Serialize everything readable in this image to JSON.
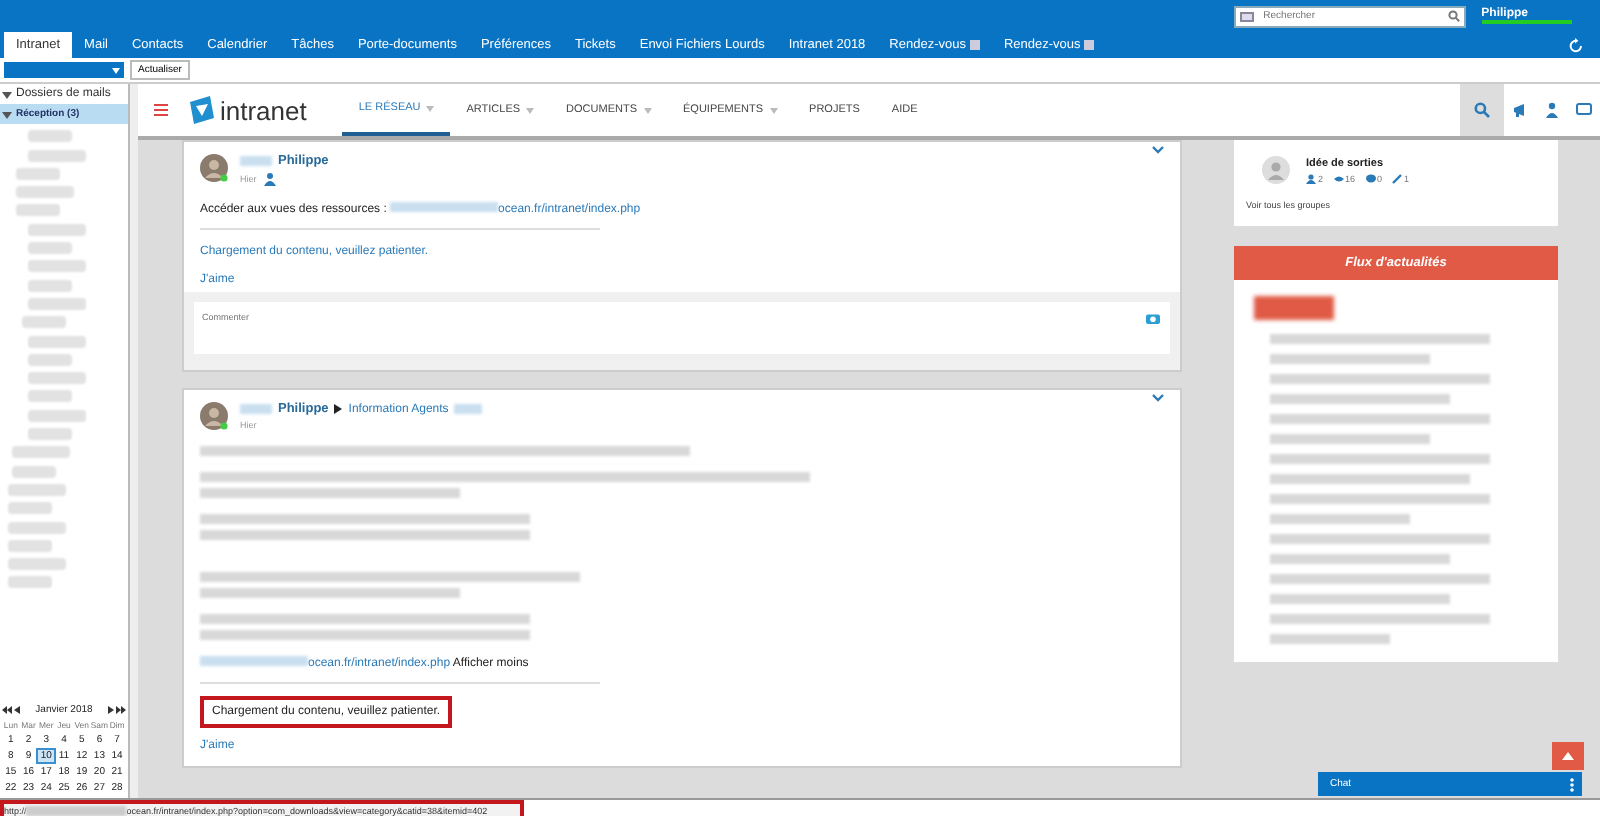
{
  "top_bar": {
    "search": {
      "placeholder": "Rechercher"
    },
    "user": "Philippe"
  },
  "tabs": [
    {
      "label": "Intranet",
      "selected": true,
      "closable": false
    },
    {
      "label": "Mail",
      "selected": false,
      "closable": false
    },
    {
      "label": "Contacts",
      "selected": false,
      "closable": false
    },
    {
      "label": "Calendrier",
      "selected": false,
      "closable": false
    },
    {
      "label": "Tâches",
      "selected": false,
      "closable": false
    },
    {
      "label": "Porte-documents",
      "selected": false,
      "closable": false
    },
    {
      "label": "Préférences",
      "selected": false,
      "closable": false
    },
    {
      "label": "Tickets",
      "selected": false,
      "closable": false
    },
    {
      "label": "Envoi Fichiers Lourds",
      "selected": false,
      "closable": false
    },
    {
      "label": "Intranet 2018",
      "selected": false,
      "closable": false
    },
    {
      "label": "Rendez-vous",
      "selected": false,
      "closable": true
    },
    {
      "label": "Rendez-vous",
      "selected": false,
      "closable": true
    }
  ],
  "toolbar": {
    "button": "Actualiser"
  },
  "mail_folders": {
    "title": "Dossiers de mails",
    "expanded": true,
    "items": [
      {
        "label": "Réception (3)",
        "selected": true
      }
    ]
  },
  "calendar": {
    "month": "Janvier 2018",
    "weekdays": [
      "Lun",
      "Mar",
      "Mer",
      "Jeu",
      "Ven",
      "Sam",
      "Dim"
    ],
    "weeks": [
      [
        {
          "d": "1",
          "selected": false,
          "other": false
        },
        {
          "d": "2",
          "selected": false,
          "other": false
        },
        {
          "d": "3",
          "selected": false,
          "other": false
        },
        {
          "d": "4",
          "selected": false,
          "other": false
        },
        {
          "d": "5",
          "selected": false,
          "other": false
        },
        {
          "d": "6",
          "selected": false,
          "other": false
        },
        {
          "d": "7",
          "selected": false,
          "other": false
        }
      ],
      [
        {
          "d": "8",
          "selected": false,
          "other": false
        },
        {
          "d": "9",
          "selected": false,
          "other": false
        },
        {
          "d": "10",
          "selected": true,
          "other": false
        },
        {
          "d": "11",
          "selected": false,
          "other": false
        },
        {
          "d": "12",
          "selected": false,
          "other": false
        },
        {
          "d": "13",
          "selected": false,
          "other": false
        },
        {
          "d": "14",
          "selected": false,
          "other": false
        }
      ],
      [
        {
          "d": "15",
          "selected": false,
          "other": false
        },
        {
          "d": "16",
          "selected": false,
          "other": false
        },
        {
          "d": "17",
          "selected": false,
          "other": false
        },
        {
          "d": "18",
          "selected": false,
          "other": false
        },
        {
          "d": "19",
          "selected": false,
          "other": false
        },
        {
          "d": "20",
          "selected": false,
          "other": false
        },
        {
          "d": "21",
          "selected": false,
          "other": false
        }
      ],
      [
        {
          "d": "22",
          "selected": false,
          "other": false
        },
        {
          "d": "23",
          "selected": false,
          "other": false
        },
        {
          "d": "24",
          "selected": false,
          "other": false
        },
        {
          "d": "25",
          "selected": false,
          "other": false
        },
        {
          "d": "26",
          "selected": false,
          "other": false
        },
        {
          "d": "27",
          "selected": false,
          "other": false
        },
        {
          "d": "28",
          "selected": false,
          "other": false
        }
      ]
    ]
  },
  "site": {
    "logo": "intranet",
    "nav": [
      {
        "label": "LE RÉSEAU",
        "selected": true,
        "dropdown": true
      },
      {
        "label": "ARTICLES",
        "selected": false,
        "dropdown": true
      },
      {
        "label": "DOCUMENTS",
        "selected": false,
        "dropdown": true
      },
      {
        "label": "ÉQUIPEMENTS",
        "selected": false,
        "dropdown": true
      },
      {
        "label": "PROJETS",
        "selected": false,
        "dropdown": false
      },
      {
        "label": "AIDE",
        "selected": false,
        "dropdown": false
      }
    ]
  },
  "posts": [
    {
      "author": "Philippe",
      "time": "Hier",
      "text": "Accéder aux vues des ressources :",
      "link": "ocean.fr/intranet/index.php",
      "loading": "Chargement du contenu, veuillez patienter.",
      "loading_highlighted": false,
      "like": "J'aime",
      "comment": {
        "placeholder": "Commenter"
      }
    },
    {
      "author": "Philippe",
      "target": "Information Agents",
      "time": "Hier",
      "blurred_body": true,
      "link": "ocean.fr/intranet/index.php",
      "more": "Afficher moins",
      "loading": "Chargement du contenu, veuillez patienter.",
      "loading_highlighted": true,
      "like": "J'aime"
    }
  ],
  "group": {
    "name": "Idée de sorties",
    "stats": [
      "2",
      "16",
      "0",
      "1"
    ],
    "link": "Voir tous les groupes"
  },
  "news": {
    "title": "Flux d'actualités"
  },
  "chat": {
    "label": "Chat"
  },
  "status_bar": {
    "url_start": "http://",
    "url_end": "ocean.fr/intranet/index.php?option=com_downloads&view=category&catid=38&itemid=402"
  }
}
